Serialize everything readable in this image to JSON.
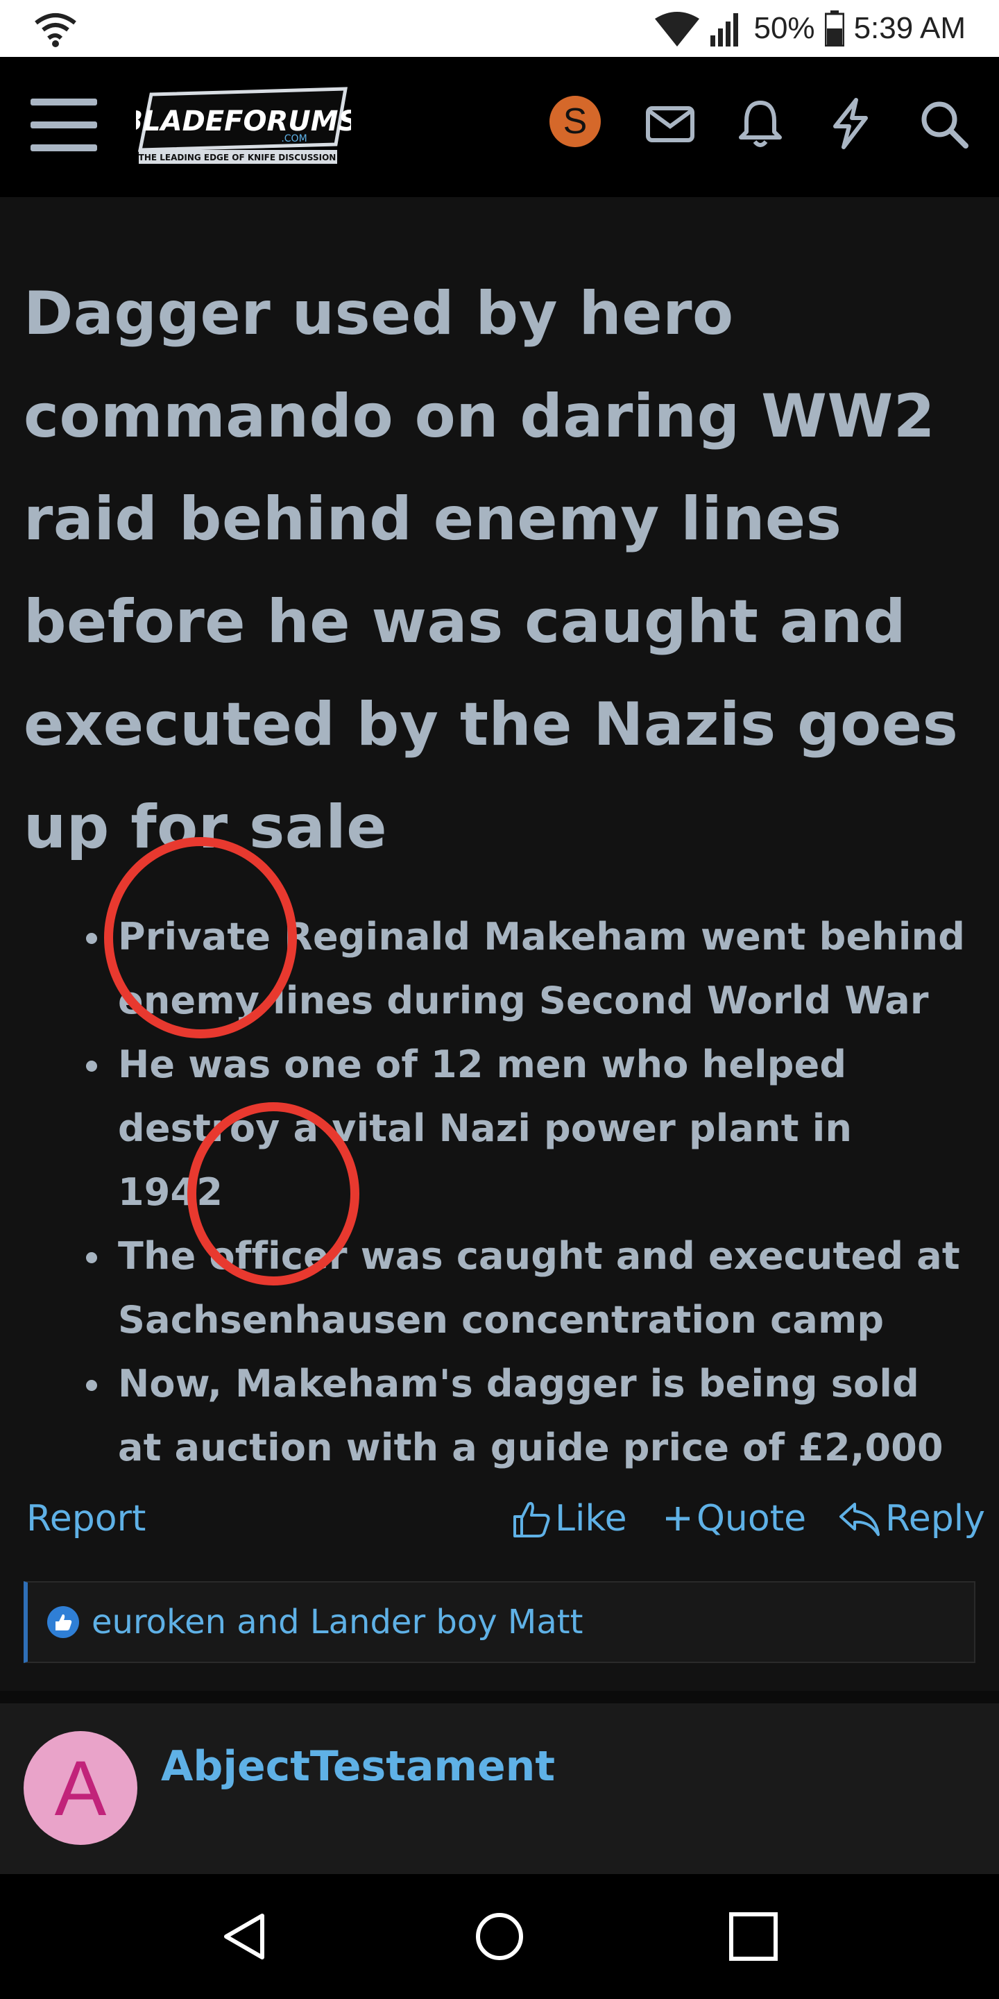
{
  "status_bar": {
    "battery": "50%",
    "time": "5:39 AM",
    "icons": [
      "wifi-calling-icon",
      "wifi-icon",
      "signal-icon",
      "battery-icon"
    ]
  },
  "header": {
    "logo": {
      "name": "BLADEFORUMS",
      "domain": ".COM",
      "tagline": "THE LEADING EDGE OF KNIFE DISCUSSION"
    },
    "avatar_letter": "S",
    "avatar_color": "#d5682a",
    "icons": [
      "menu-icon",
      "mail-icon",
      "bell-icon",
      "bolt-icon",
      "search-icon"
    ]
  },
  "post": {
    "title": "Dagger used by hero commando on daring WW2 raid behind enemy lines before he was caught and executed by the Nazis goes up for sale",
    "bullets": [
      "Private Reginald Makeham went behind enemy lines during Second World War",
      "He was one of 12 men who helped destroy a vital Nazi power plant in 1942",
      "The officer was caught and executed at Sachsenhausen concentration camp",
      "Now, Makeham's dagger is being sold at auction with a guide price of £2,000"
    ]
  },
  "actions": {
    "report": "Report",
    "like": "Like",
    "quote": "Quote",
    "reply": "Reply"
  },
  "reactions": {
    "text": "euroken and Lander boy Matt"
  },
  "next_post": {
    "avatar_letter": "A",
    "username": "AbjectTestament"
  },
  "nav": [
    "back-icon",
    "home-icon",
    "recents-icon"
  ],
  "colors": {
    "background": "#121212",
    "title": "#a7b4c1",
    "link": "#5fb1e6",
    "annotation": "#e8392f"
  }
}
